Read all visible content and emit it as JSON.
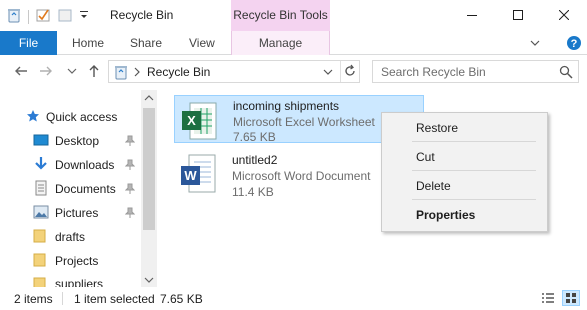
{
  "window": {
    "title": "Recycle Bin",
    "contextual_tab": "Recycle Bin Tools",
    "minimize_icon": "minimize-icon",
    "maximize_icon": "maximize-icon",
    "close_icon": "close-icon"
  },
  "ribbon": {
    "tabs": [
      "File",
      "Home",
      "Share",
      "View",
      "Manage"
    ]
  },
  "address": {
    "path": "Recycle Bin",
    "search_placeholder": "Search Recycle Bin"
  },
  "nav": {
    "items": [
      {
        "label": "Quick access",
        "icon": "star-icon",
        "pinned": false
      },
      {
        "label": "Desktop",
        "icon": "desktop-icon",
        "pinned": true
      },
      {
        "label": "Downloads",
        "icon": "download-icon",
        "pinned": true
      },
      {
        "label": "Documents",
        "icon": "documents-icon",
        "pinned": true
      },
      {
        "label": "Pictures",
        "icon": "pictures-icon",
        "pinned": true
      },
      {
        "label": "drafts",
        "icon": "folder-icon",
        "pinned": false
      },
      {
        "label": "Projects",
        "icon": "folder-icon",
        "pinned": false
      },
      {
        "label": "suppliers",
        "icon": "folder-icon",
        "pinned": false
      }
    ]
  },
  "files": [
    {
      "name": "incoming shipments",
      "type": "Microsoft Excel Worksheet",
      "size": "7.65 KB",
      "icon": "excel-icon",
      "selected": true
    },
    {
      "name": "untitled2",
      "type": "Microsoft Word Document",
      "size": "11.4 KB",
      "icon": "word-icon",
      "selected": false
    }
  ],
  "context_menu": {
    "restore": "Restore",
    "cut": "Cut",
    "delete": "Delete",
    "properties": "Properties"
  },
  "status": {
    "count": "2 items",
    "selection": "1 item selected",
    "selection_size": "7.65 KB"
  },
  "colors": {
    "file_tab": "#1979ca",
    "tools_tab": "#f4d3f0",
    "selection": "#cce8ff"
  }
}
